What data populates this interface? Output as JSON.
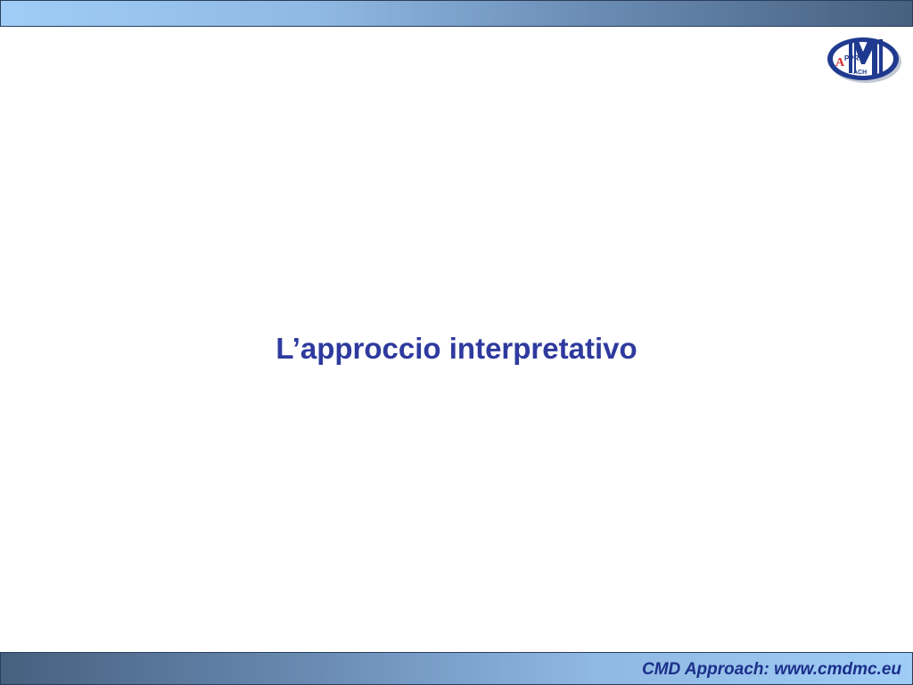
{
  "header": {
    "logo": {
      "icon": "cmd-approach-logo-icon",
      "letters_m": "M",
      "letters_appro": "PPRO",
      "letter_a": "A",
      "letters_ach": "ACH",
      "colors": {
        "ring": "#1f3a8f",
        "fill": "#ffffff",
        "accent": "#d42a2a"
      }
    },
    "bar_colors": {
      "light": "#9fcdf6",
      "dark": "#46607f"
    }
  },
  "main": {
    "title": "L’approccio interpretativo"
  },
  "footer": {
    "text": "CMD Approach: www.cmdmc.eu"
  },
  "colors": {
    "title": "#2e3a9e",
    "footer_text": "#1c2f8a"
  }
}
